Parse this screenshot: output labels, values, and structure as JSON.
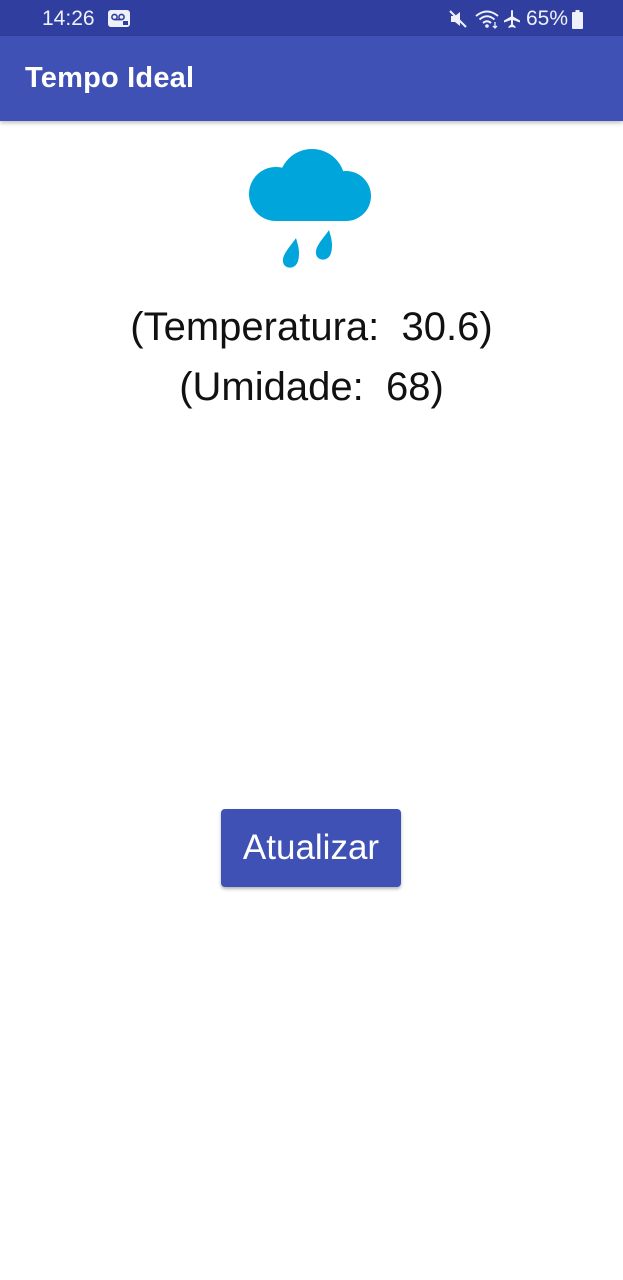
{
  "status_bar": {
    "time": "14:26",
    "battery": "65%",
    "icons": [
      "voicemail-icon",
      "mute-icon",
      "wifi-icon",
      "airplane-icon",
      "battery-icon"
    ]
  },
  "app_bar": {
    "title": "Tempo Ideal",
    "color": "#3F51B5"
  },
  "weather": {
    "icon": "rain-cloud-icon",
    "icon_color": "#00A5DC",
    "temperature_line": "(Temperatura:  30.6)",
    "humidity_line": "(Umidade:  68)"
  },
  "actions": {
    "update_label": "Atualizar"
  }
}
